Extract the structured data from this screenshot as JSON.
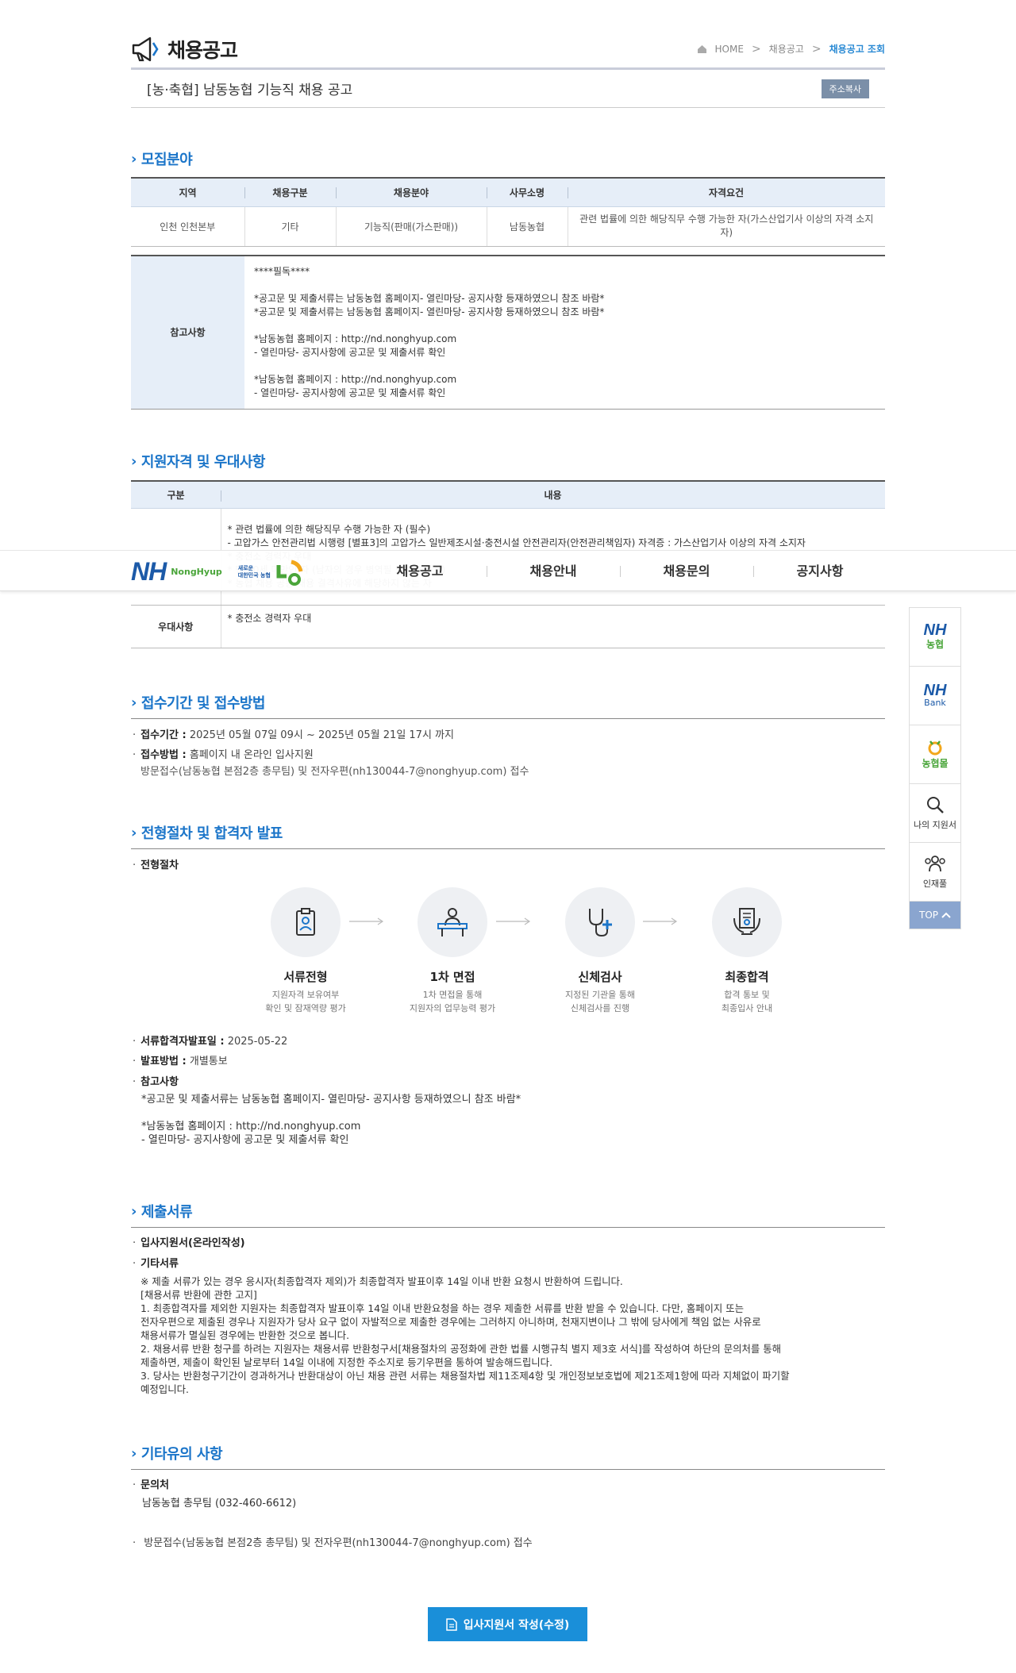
{
  "header": {
    "title": "채용공고",
    "breadcrumb": {
      "home": "HOME",
      "mid": "채용공고",
      "current": "채용공고 조회"
    }
  },
  "notice": {
    "title": "[농·축협] 남동농협 기능직 채용 공고",
    "copy_label": "주소복사"
  },
  "recruit": {
    "section_title": "모집분야",
    "headers": [
      "지역",
      "채용구분",
      "채용분야",
      "사무소명",
      "자격요건"
    ],
    "row": [
      "인천 인천본부",
      "기타",
      "기능직(판매(가스판매))",
      "남동농협",
      "관련 법률에 의한 해당직무 수행 가능한 자(가스산업기사 이상의 자격 소지자)"
    ]
  },
  "reference": {
    "label": "참고사항",
    "text": "****필독****\n\n*공고문 및 제출서류는 남동농협 홈페이지- 열린마당- 공지사항 등재하였으니 참조 바람*\n*공고문 및 제출서류는 남동농협 홈페이지- 열린마당- 공지사항 등재하였으니 참조 바람*\n\n*남동농협 홈페이지 : http://nd.nonghyup.com\n- 열린마당- 공지사항에 공고문 및 제출서류 확인\n\n*남동농협 홈페이지 : http://nd.nonghyup.com\n- 열린마당- 공지사항에 공고문 및 제출서류 확인"
  },
  "qualification": {
    "section_title": "지원자격 및 우대사항",
    "headers": [
      "구분",
      "내용"
    ],
    "row1": {
      "label": "",
      "text": "* 관련 법률에 의한 해당직무 수행 가능한 자 (필수)\n - 고압가스 안전관리법 시행령 [별표3]의 고압가스 일반제조시설·충전시설 안전관리자(안전관리책임자) 자격증 : 가스산업기사 이상의 자격 소지자\n* 충전소 경력자 우대\n* 만 60세 미만인 자 (남자의 경우 병역필 또는 면제자)\n* 농협 채용 공통 채용 결격사유에 해당하지 않는 자"
    },
    "row2": {
      "label": "우대사항",
      "text": "* 충전소 경력자 우대"
    }
  },
  "reception": {
    "section_title": "접수기간 및 접수방법",
    "period_label": "접수기간 :",
    "period_value": "2025년 05월 07일 09시 ~ 2025년 05월 21일 17시 까지",
    "method_label": "접수방법 :",
    "method_value": "홈페이지 내 온라인 입사지원",
    "method_extra": "방문접수(남동농협 본점2층 총무팀) 및 전자우편(nh130044-7@nonghyup.com) 접수"
  },
  "process": {
    "section_title": "전형절차 및 합격자 발표",
    "label": "전형절차",
    "steps": [
      {
        "name": "서류전형",
        "desc": "지원자격 보유여부\n확인 및 잠재역량 평가",
        "icon": "document-clipboard-icon"
      },
      {
        "name": "1차 면접",
        "desc": "1차 면접을 통해\n지원자의 업무능력 평가",
        "icon": "interview-person-icon"
      },
      {
        "name": "신체검사",
        "desc": "지정된 기관을 통해\n신체검사를 진행",
        "icon": "stethoscope-icon"
      },
      {
        "name": "최종합격",
        "desc": "합격 통보 및\n최종입사 안내",
        "icon": "certificate-icon"
      }
    ],
    "announce_date_label": "서류합격자발표일 :",
    "announce_date_value": "2025-05-22",
    "announce_method_label": "발표방법 :",
    "announce_method_value": "개별통보",
    "note_label": "참고사항",
    "note_text": "*공고문 및 제출서류는 남동농협 홈페이지- 열린마당- 공지사항 등재하였으니 참조 바람*\n\n*남동농협 홈페이지 : http://nd.nonghyup.com\n- 열린마당- 공지사항에 공고문 및 제출서류 확인"
  },
  "documents": {
    "section_title": "제출서류",
    "item1": "입사지원서(온라인작성)",
    "item2": "기타서류",
    "item2_text": "※ 제출 서류가 있는 경우 응시자(최종합격자 제외)가 최종합격자 발표이후 14일 이내 반환 요청시 반환하여 드립니다.\n[채용서류 반환에 관한 고지]\n 1. 최종합격자를 제외한 지원자는 최종합격자 발표이후 14일 이내 반환요청을 하는 경우 제출한 서류를 반환 받을 수 있습니다. 다만, 홈페이지 또는\n전자우편으로 제출된 경우나 지원자가 당사 요구 없이 자발적으로 제출한 경우에는 그러하지 아니하며, 천재지변이나 그 밖에 당사에게 책임 없는 사유로\n채용서류가 멸실된 경우에는 반환한 것으로 봅니다.\n 2. 채용서류 반환 청구를 하려는 지원자는 채용서류 반환청구서[채용절차의 공정화에 관한 법률 시행규칙 별지 제3호 서식]를 작성하여 하단의 문의처를 통해\n제출하면, 제출이 확인된 날로부터 14일 이내에 지정한 주소지로 등기우편을 통하여 발송해드립니다.\n 3. 당사는 반환청구기간이 경과하거나 반환대상이 아닌 채용 관련 서류는 채용절차법 제11조제4항 및 개인정보보호법에 제21조제1항에 따라 지체없이 파기할\n예정입니다."
  },
  "etc": {
    "section_title": "기타유의 사항",
    "contact_label": "문의처",
    "contact_value": "남동농협 총무팀 (032-460-6612)",
    "visit_text": "방문접수(남동농협 본점2층 총무팀) 및 전자우편(nh130044-7@nonghyup.com) 접수"
  },
  "apply_button": "입사지원서 작성(수정)",
  "nav": {
    "logo": "NH",
    "logo_sub": "NongHyup",
    "logo_slogan1": "새로운",
    "logo_slogan2": "대한민국 농협",
    "items": [
      "채용공고",
      "채용안내",
      "채용문의",
      "공지사항"
    ]
  },
  "quick_menu": {
    "nh1_top": "NH",
    "nh1_bottom": "농협",
    "nh2_top": "NH",
    "nh2_bottom": "Bank",
    "nh3": "농협몰",
    "my_apply": "나의 지원서",
    "talent": "인재풀",
    "top": "TOP"
  },
  "colors": {
    "accent": "#1b75c9",
    "header_bg": "#e6eef8",
    "button": "#1a8fd9",
    "quick_top": "#8aa5cf"
  }
}
